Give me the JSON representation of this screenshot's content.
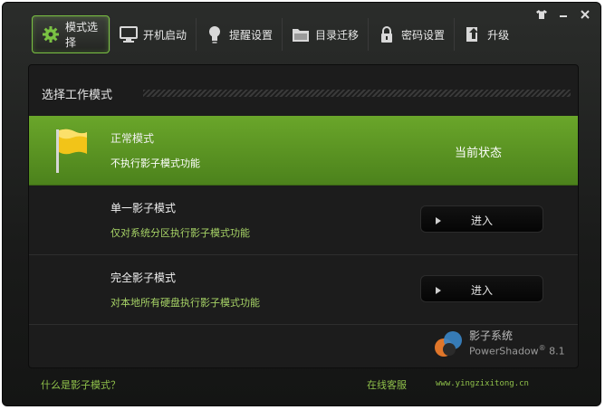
{
  "window_controls": {
    "skin_icon": "shirt-icon",
    "minimize_icon": "minimize-icon",
    "close_icon": "close-icon"
  },
  "tabs": [
    {
      "label": "模式选择",
      "icon": "gear-icon",
      "active": true
    },
    {
      "label": "开机启动",
      "icon": "monitor-icon",
      "active": false
    },
    {
      "label": "提醒设置",
      "icon": "bulb-icon",
      "active": false
    },
    {
      "label": "目录迁移",
      "icon": "folder-icon",
      "active": false
    },
    {
      "label": "密码设置",
      "icon": "lock-icon",
      "active": false
    },
    {
      "label": "升级",
      "icon": "upgrade-icon",
      "active": false
    }
  ],
  "panel": {
    "title": "选择工作模式",
    "modes": [
      {
        "name": "正常模式",
        "desc": "不执行影子模式功能",
        "state": "当前状态"
      },
      {
        "name": "单一影子模式",
        "desc": "仅对系统分区执行影子模式功能",
        "button": "进入"
      },
      {
        "name": "完全影子模式",
        "desc": "对本地所有硬盘执行影子模式功能",
        "button": "进入"
      }
    ]
  },
  "brand": {
    "name": "影子系统",
    "product": "PowerShadow",
    "version": "8.1",
    "mark": "®"
  },
  "footer": {
    "help_link": "什么是影子模式？",
    "service_link": "在线客服",
    "url": "www.yingzixitong.cn"
  },
  "colors": {
    "accent": "#7ac143",
    "current_row": "#5a9423",
    "desc_text": "#a6d266"
  }
}
